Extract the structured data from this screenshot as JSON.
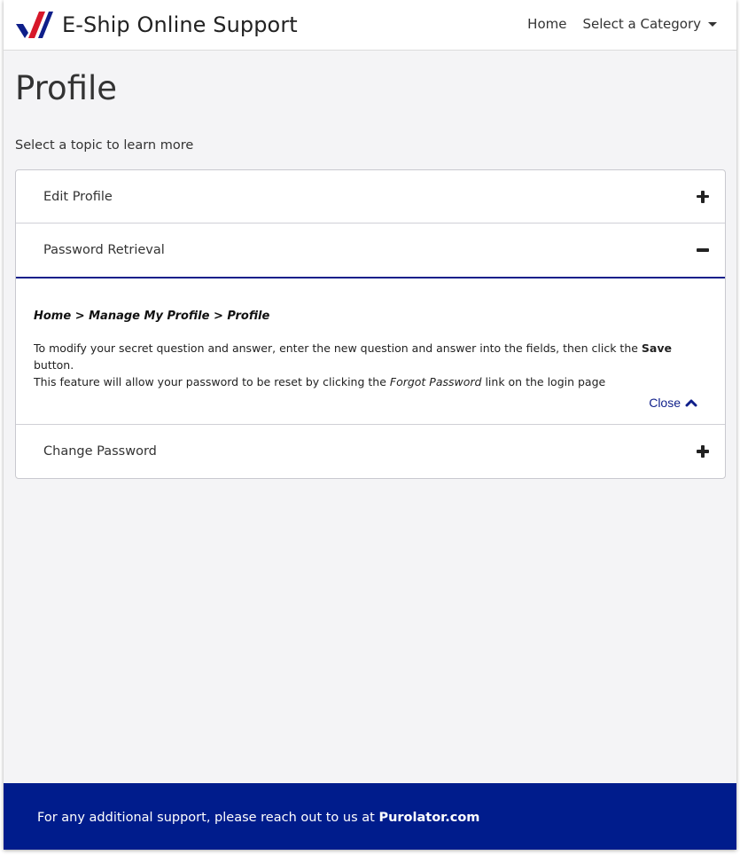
{
  "app": {
    "name": "E-Ship Online Support"
  },
  "nav": {
    "home": "Home",
    "category": "Select a Category"
  },
  "page": {
    "title": "Profile",
    "subtitle": "Select a topic to learn more"
  },
  "accordion": {
    "items": [
      {
        "label": "Edit Profile",
        "state": "collapsed"
      },
      {
        "label": "Password Retrieval",
        "state": "expanded"
      },
      {
        "label": "Change Password",
        "state": "collapsed"
      }
    ],
    "expanded": {
      "breadcrumb": "Home > Manage My Profile > Profile",
      "text1": "To modify your secret question and answer, enter the new question and answer into the fields, then click the ",
      "text1_bold": "Save",
      "text1_end": " button.",
      "text2_pre": "This feature will allow your password to be reset by clicking the ",
      "text2_italic": "Forgot Password",
      "text2_post": " link on the login page",
      "close_label": "Close"
    }
  },
  "footer": {
    "text": "For any additional support, please reach out to us at ",
    "link": "Purolator.com"
  },
  "colors": {
    "brand_red": "#d7182a",
    "brand_navy": "#0f1f8a",
    "footer_bg": "#001c8c"
  }
}
